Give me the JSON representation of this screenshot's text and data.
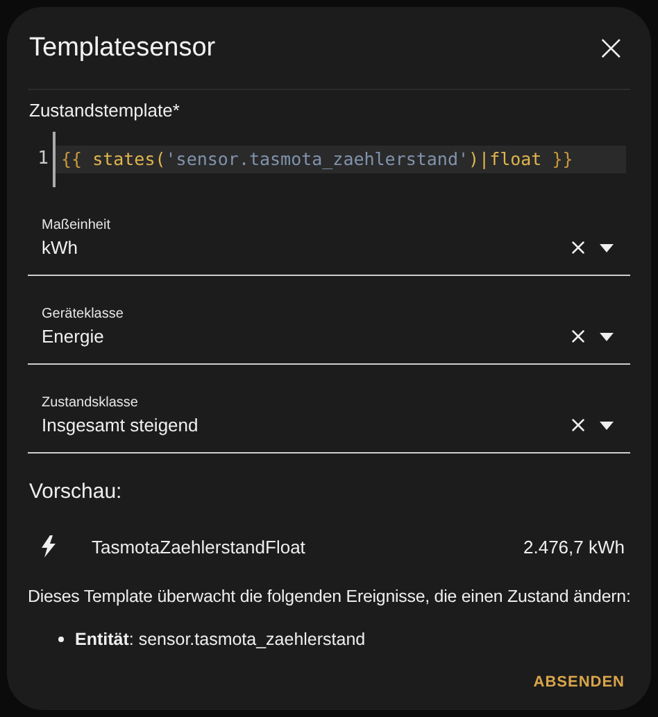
{
  "dialog": {
    "title": "Templatesensor",
    "close_label": "×"
  },
  "template": {
    "label": "Zustandstemplate*",
    "line_number": "1",
    "tokens": [
      {
        "kind": "brace",
        "text": "{{ "
      },
      {
        "kind": "func",
        "text": "states("
      },
      {
        "kind": "string",
        "text": "'sensor.tasmota_zaehlerstand'"
      },
      {
        "kind": "func",
        "text": ")"
      },
      {
        "kind": "filter",
        "text": "|float"
      },
      {
        "kind": "brace",
        "text": " }}"
      }
    ]
  },
  "fields": [
    {
      "label": "Maßeinheit",
      "value": "kWh"
    },
    {
      "label": "Geräteklasse",
      "value": "Energie"
    },
    {
      "label": "Zustandsklasse",
      "value": "Insgesamt steigend"
    }
  ],
  "preview": {
    "heading": "Vorschau:",
    "entity_name": "TasmotaZaehlerstandFloat",
    "state": "2.476,7 kWh"
  },
  "listeners": {
    "text": "Dieses Template überwacht die folgenden Ereignisse, die einen Zustand ändern:",
    "items": [
      "**Entität**: sensor.tasmota_zaehlerstand"
    ]
  },
  "actions": [
    "ABSENDEN"
  ]
}
